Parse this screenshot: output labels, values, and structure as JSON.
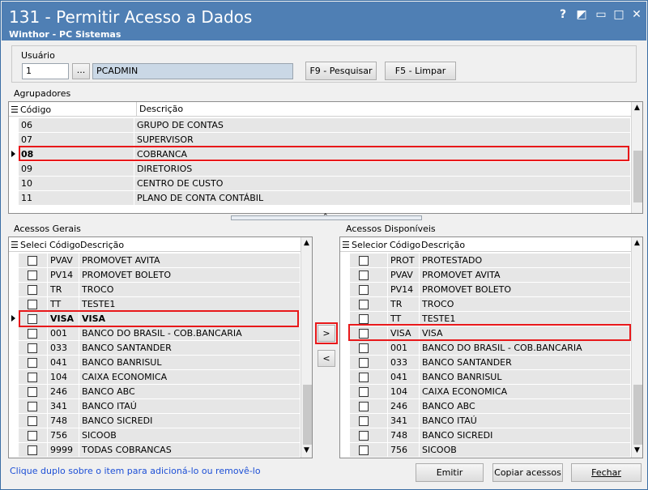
{
  "window": {
    "title": "131 - Permitir Acesso a Dados",
    "subtitle": "Winthor - PC Sistemas",
    "help": "?",
    "restore": "◩",
    "minimize": "▭",
    "maximize": "□",
    "close": "✕"
  },
  "usuario": {
    "label": "Usuário",
    "code": "1",
    "lookup": "...",
    "name": "PCADMIN",
    "btn_pesquisar": "F9 - Pesquisar",
    "btn_limpar": "F5 - Limpar"
  },
  "agrupadores": {
    "label": "Agrupadores",
    "col_codigo": "Código",
    "col_descricao": "Descrição",
    "rows": [
      {
        "codigo": "06",
        "descricao": "GRUPO DE CONTAS"
      },
      {
        "codigo": "07",
        "descricao": "SUPERVISOR"
      },
      {
        "codigo": "08",
        "descricao": "COBRANCA"
      },
      {
        "codigo": "09",
        "descricao": "DIRETORIOS"
      },
      {
        "codigo": "10",
        "descricao": "CENTRO DE CUSTO"
      },
      {
        "codigo": "11",
        "descricao": "PLANO DE CONTA CONTÁBIL"
      }
    ]
  },
  "acessos_gerais": {
    "label": "Acessos Gerais",
    "col_sel": "Selecion",
    "col_codigo": "Código",
    "col_descricao": "Descrição",
    "rows": [
      {
        "codigo": "PVAV",
        "descricao": "PROMOVET AVITA"
      },
      {
        "codigo": "PV14",
        "descricao": "PROMOVET BOLETO"
      },
      {
        "codigo": "TR",
        "descricao": "TROCO"
      },
      {
        "codigo": "TT",
        "descricao": "TESTE1"
      },
      {
        "codigo": "VISA",
        "descricao": "VISA"
      },
      {
        "codigo": "001",
        "descricao": "BANCO DO BRASIL - COB.BANCARIA"
      },
      {
        "codigo": "033",
        "descricao": "BANCO SANTANDER"
      },
      {
        "codigo": "041",
        "descricao": "BANCO BANRISUL"
      },
      {
        "codigo": "104",
        "descricao": "CAIXA ECONOMICA"
      },
      {
        "codigo": "246",
        "descricao": "BANCO ABC"
      },
      {
        "codigo": "341",
        "descricao": "BANCO ITAÚ"
      },
      {
        "codigo": "748",
        "descricao": "BANCO SICREDI"
      },
      {
        "codigo": "756",
        "descricao": "SICOOB"
      },
      {
        "codigo": "9999",
        "descricao": "TODAS COBRANCAS"
      }
    ]
  },
  "acessos_disponiveis": {
    "label": "Acessos Disponíveis",
    "col_sel": "Selecionad",
    "col_codigo": "Código",
    "col_descricao": "Descrição",
    "rows": [
      {
        "codigo": "PROT",
        "descricao": "PROTESTADO"
      },
      {
        "codigo": "PVAV",
        "descricao": "PROMOVET AVITA"
      },
      {
        "codigo": "PV14",
        "descricao": "PROMOVET BOLETO"
      },
      {
        "codigo": "TR",
        "descricao": "TROCO"
      },
      {
        "codigo": "TT",
        "descricao": "TESTE1"
      },
      {
        "codigo": "VISA",
        "descricao": "VISA"
      },
      {
        "codigo": "001",
        "descricao": "BANCO DO BRASIL - COB.BANCARIA"
      },
      {
        "codigo": "033",
        "descricao": "BANCO SANTANDER"
      },
      {
        "codigo": "041",
        "descricao": "BANCO BANRISUL"
      },
      {
        "codigo": "104",
        "descricao": "CAIXA ECONOMICA"
      },
      {
        "codigo": "246",
        "descricao": "BANCO ABC"
      },
      {
        "codigo": "341",
        "descricao": "BANCO ITAÚ"
      },
      {
        "codigo": "748",
        "descricao": "BANCO SICREDI"
      },
      {
        "codigo": "756",
        "descricao": "SICOOB"
      }
    ]
  },
  "transfer": {
    "add": ">",
    "remove": "<"
  },
  "footer": {
    "hint": "Clique duplo sobre o item para adicioná-lo ou removê-lo",
    "btn_emitir": "Emitir",
    "btn_copiar": "Copiar acessos",
    "btn_fechar": "Fechar"
  },
  "colors": {
    "titlebar": "#4f7fb4",
    "highlight": "#e8181a",
    "hint": "#1c4fd6"
  }
}
